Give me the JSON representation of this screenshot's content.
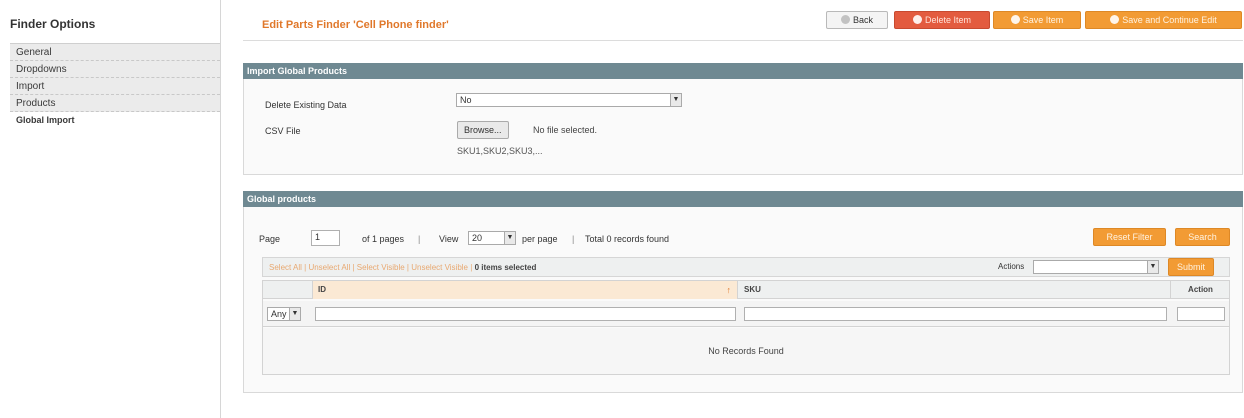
{
  "sidebar": {
    "title": "Finder Options",
    "tabs": [
      {
        "label": "General"
      },
      {
        "label": "Dropdowns"
      },
      {
        "label": "Import"
      },
      {
        "label": "Products"
      },
      {
        "label": "Global Import"
      }
    ]
  },
  "header": {
    "title": "Edit Parts Finder 'Cell Phone finder'",
    "buttons": {
      "back": "Back",
      "delete": "Delete Item",
      "save": "Save Item",
      "save_continue": "Save and Continue Edit"
    }
  },
  "import_section": {
    "heading": "Import Global Products",
    "delete_existing_label": "Delete Existing Data",
    "delete_existing_value": "No",
    "csv_label": "CSV File",
    "browse_label": "Browse...",
    "file_status": "No file selected.",
    "csv_hint": "SKU1,SKU2,SKU3,..."
  },
  "products_section": {
    "heading": "Global products",
    "pager": {
      "page_label": "Page",
      "page_value": "1",
      "of_pages": "of 1 pages",
      "view_label": "View",
      "per_page_value": "20",
      "per_page_label": "per page",
      "records_found": "Total 0 records found"
    },
    "buttons": {
      "reset_filter": "Reset Filter",
      "search": "Search",
      "submit": "Submit"
    },
    "massaction": {
      "select_all": "Select All",
      "unselect_all": "Unselect All",
      "select_visible": "Select Visible",
      "unselect_visible": "Unselect Visible",
      "items_selected": "0 items selected",
      "actions_label": "Actions",
      "separator": "|"
    },
    "grid": {
      "columns": [
        "ID",
        "SKU",
        "Action"
      ],
      "sort_indicator": "↑",
      "filter_any": "Any",
      "empty_message": "No Records Found"
    }
  },
  "colors": {
    "accent_orange": "#f29b34",
    "delete_red": "#e35b3f",
    "section_header": "#6f8992",
    "title_orange": "#e0782b"
  }
}
